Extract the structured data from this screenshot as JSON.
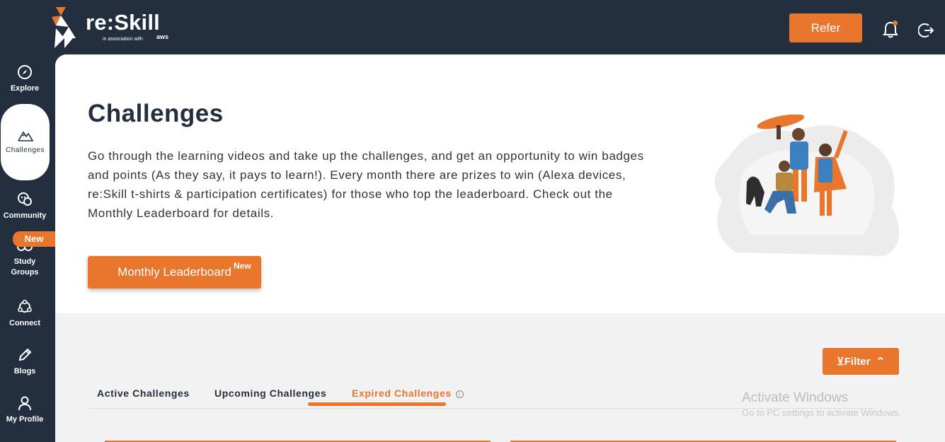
{
  "header": {
    "logo_text": "re:Skill",
    "logo_sub": "in association with",
    "logo_partner": "aws",
    "refer_label": "Refer"
  },
  "sidebar": {
    "items": [
      {
        "label": "Explore",
        "icon": "compass-icon"
      },
      {
        "label": "Challenges",
        "icon": "mountain-icon"
      },
      {
        "label": "Community",
        "icon": "community-icon"
      },
      {
        "label": "Study\nGroups",
        "icon": "group-icon"
      },
      {
        "label": "Connect",
        "icon": "connect-icon"
      },
      {
        "label": "Blogs",
        "icon": "pen-icon"
      },
      {
        "label": "My Profile",
        "icon": "user-icon"
      }
    ],
    "new_badge": "New"
  },
  "hero": {
    "title": "Challenges",
    "description": "Go through the learning videos and take up the challenges, and get an opportunity to win badges and points (As they say, it pays to learn!). Every month there are prizes to win (Alexa devices, re:Skill t-shirts & participation certificates) for those who top the leaderboard. Check out the Monthly Leaderboard for details.",
    "leaderboard_label": "Monthly Leaderboard",
    "leaderboard_badge": "New"
  },
  "challenges": {
    "filter_label": "Filter",
    "tabs": [
      {
        "label": "Active Challenges"
      },
      {
        "label": "Upcoming Challenges"
      },
      {
        "label": "Expired Challenges"
      }
    ],
    "active_tab": "Expired Challenges"
  },
  "watermark": {
    "line1": "Activate Windows",
    "line2": "Go to PC settings to activate Windows."
  },
  "colors": {
    "brand_dark": "#232f3e",
    "accent": "#e8762c"
  }
}
